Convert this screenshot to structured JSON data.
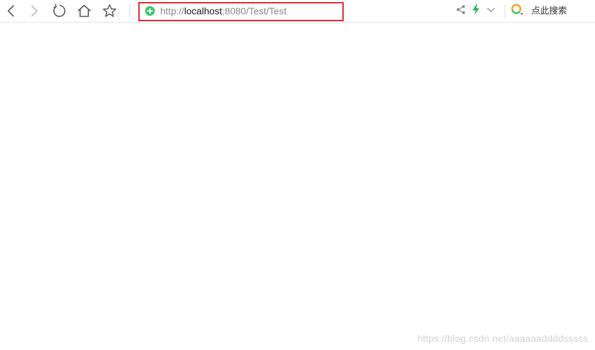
{
  "address_bar": {
    "scheme": "http://",
    "host": "localhost",
    "rest": ":8080/Test/Test"
  },
  "search": {
    "label": "点此搜索"
  },
  "watermark": "https://blog.csdn.net/aaaaaaddddsssss",
  "icons": {
    "back": "chevron-left-icon",
    "forward": "chevron-right-icon",
    "reload": "reload-icon",
    "home": "home-icon",
    "favorite": "star-icon",
    "site": "shield-plus-icon",
    "share": "share-icon",
    "speed": "lightning-icon",
    "dropdown": "chevron-down-icon",
    "search_engine": "search-engine-logo-icon"
  },
  "colors": {
    "highlight_box": "#e0282e",
    "site_icon": "#3cc46a",
    "lightning": "#2fb55a",
    "url_host": "#1a1a1a",
    "url_dim": "#8a8a8a"
  }
}
